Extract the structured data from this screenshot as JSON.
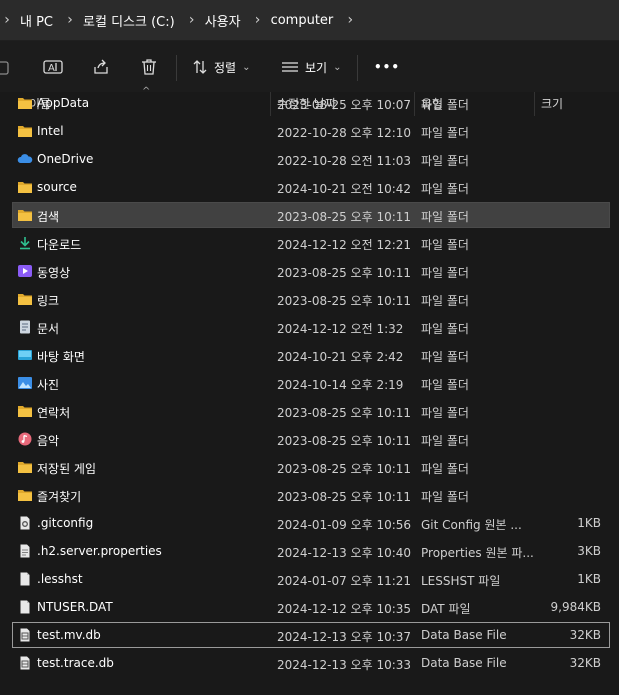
{
  "breadcrumb": [
    "내 PC",
    "로컬 디스크 (C:)",
    "사용자",
    "computer"
  ],
  "toolbar": {
    "sort_label": "정렬",
    "view_label": "보기",
    "more_label": "•••"
  },
  "columns": {
    "name": "이름",
    "date": "수정한 날짜",
    "type": "유형",
    "size": "크기"
  },
  "files": [
    {
      "name": "AppData",
      "date": "2023-08-25 오후 10:07",
      "type": "파일 폴더",
      "size": "",
      "icon": "folder-icon"
    },
    {
      "name": "Intel",
      "date": "2022-10-28 오후 12:10",
      "type": "파일 폴더",
      "size": "",
      "icon": "folder-icon"
    },
    {
      "name": "OneDrive",
      "date": "2022-10-28 오전 11:03",
      "type": "파일 폴더",
      "size": "",
      "icon": "cloud-icon"
    },
    {
      "name": "source",
      "date": "2024-10-21 오전 10:42",
      "type": "파일 폴더",
      "size": "",
      "icon": "folder-icon"
    },
    {
      "name": "검색",
      "date": "2023-08-25 오후 10:11",
      "type": "파일 폴더",
      "size": "",
      "icon": "folder-icon"
    },
    {
      "name": "다운로드",
      "date": "2024-12-12 오전 12:21",
      "type": "파일 폴더",
      "size": "",
      "icon": "download-icon"
    },
    {
      "name": "동영상",
      "date": "2023-08-25 오후 10:11",
      "type": "파일 폴더",
      "size": "",
      "icon": "video-icon"
    },
    {
      "name": "링크",
      "date": "2023-08-25 오후 10:11",
      "type": "파일 폴더",
      "size": "",
      "icon": "folder-icon"
    },
    {
      "name": "문서",
      "date": "2024-12-12 오전 1:32",
      "type": "파일 폴더",
      "size": "",
      "icon": "document-icon"
    },
    {
      "name": "바탕 화면",
      "date": "2024-10-21 오후 2:42",
      "type": "파일 폴더",
      "size": "",
      "icon": "desktop-icon"
    },
    {
      "name": "사진",
      "date": "2024-10-14 오후 2:19",
      "type": "파일 폴더",
      "size": "",
      "icon": "picture-icon"
    },
    {
      "name": "연락처",
      "date": "2023-08-25 오후 10:11",
      "type": "파일 폴더",
      "size": "",
      "icon": "folder-icon"
    },
    {
      "name": "음악",
      "date": "2023-08-25 오후 10:11",
      "type": "파일 폴더",
      "size": "",
      "icon": "music-icon"
    },
    {
      "name": "저장된 게임",
      "date": "2023-08-25 오후 10:11",
      "type": "파일 폴더",
      "size": "",
      "icon": "folder-icon"
    },
    {
      "name": "즐겨찾기",
      "date": "2023-08-25 오후 10:11",
      "type": "파일 폴더",
      "size": "",
      "icon": "folder-icon"
    },
    {
      "name": ".gitconfig",
      "date": "2024-01-09 오후 10:56",
      "type": "Git Config 원본 ...",
      "size": "1KB",
      "icon": "gear-file-icon"
    },
    {
      "name": ".h2.server.properties",
      "date": "2024-12-13 오후 10:40",
      "type": "Properties 원본 파...",
      "size": "3KB",
      "icon": "text-file-icon"
    },
    {
      "name": ".lesshst",
      "date": "2024-01-07 오후 11:21",
      "type": "LESSHST 파일",
      "size": "1KB",
      "icon": "blank-file-icon"
    },
    {
      "name": "NTUSER.DAT",
      "date": "2024-12-12 오후 10:35",
      "type": "DAT 파일",
      "size": "9,984KB",
      "icon": "blank-file-icon"
    },
    {
      "name": "test.mv.db",
      "date": "2024-12-13 오후 10:37",
      "type": "Data Base File",
      "size": "32KB",
      "icon": "db-file-icon"
    },
    {
      "name": "test.trace.db",
      "date": "2024-12-13 오후 10:33",
      "type": "Data Base File",
      "size": "32KB",
      "icon": "db-file-icon"
    }
  ],
  "selected_index": 4,
  "focused_index": 19,
  "colors": {
    "folder": "#f4c142",
    "accent": "#4aa3f0",
    "selected_bg": "#414141"
  }
}
